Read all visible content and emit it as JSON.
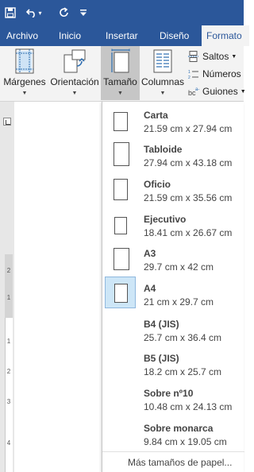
{
  "qat": {
    "save_icon": "save-icon",
    "undo_icon": "undo-icon",
    "redo_icon": "redo-icon",
    "customize_icon": "customize-qat-icon"
  },
  "tabs": [
    {
      "label": "Archivo"
    },
    {
      "label": "Inicio"
    },
    {
      "label": "Insertar"
    },
    {
      "label": "Diseño"
    },
    {
      "label": "Formato",
      "active": true
    }
  ],
  "ribbon": {
    "margenes": "Márgenes",
    "orientacion": "Orientación",
    "tamano": "Tamaño",
    "columnas": "Columnas",
    "saltos": "Saltos",
    "numeros": "Números",
    "guiones": "Guiones"
  },
  "ruler": {
    "marks": [
      "2",
      "1",
      "1",
      "2",
      "3",
      "4"
    ]
  },
  "sizes": [
    {
      "name": "Carta",
      "dims": "21.59 cm x 27.94 cm"
    },
    {
      "name": "Tabloide",
      "dims": "27.94 cm x 43.18 cm"
    },
    {
      "name": "Oficio",
      "dims": "21.59 cm x 35.56 cm"
    },
    {
      "name": "Ejecutivo",
      "dims": "18.41 cm x 26.67 cm"
    },
    {
      "name": "A3",
      "dims": "29.7 cm x 42 cm"
    },
    {
      "name": "A4",
      "dims": "21 cm x 29.7 cm",
      "selected": true
    },
    {
      "name": "B4 (JIS)",
      "dims": "25.7 cm x 36.4 cm"
    },
    {
      "name": "B5 (JIS)",
      "dims": "18.2 cm x 25.7 cm"
    },
    {
      "name": "Sobre nº10",
      "dims": "10.48 cm x 24.13 cm"
    },
    {
      "name": "Sobre monarca",
      "dims": "9.84 cm x 19.05 cm"
    }
  ],
  "more_sizes": "Más tamaños de papel...",
  "colors": {
    "title_bar": "#2b579a",
    "ribbon": "#f3f3f3",
    "pressed": "#c6c6c6",
    "selection": "#cde6f7"
  }
}
